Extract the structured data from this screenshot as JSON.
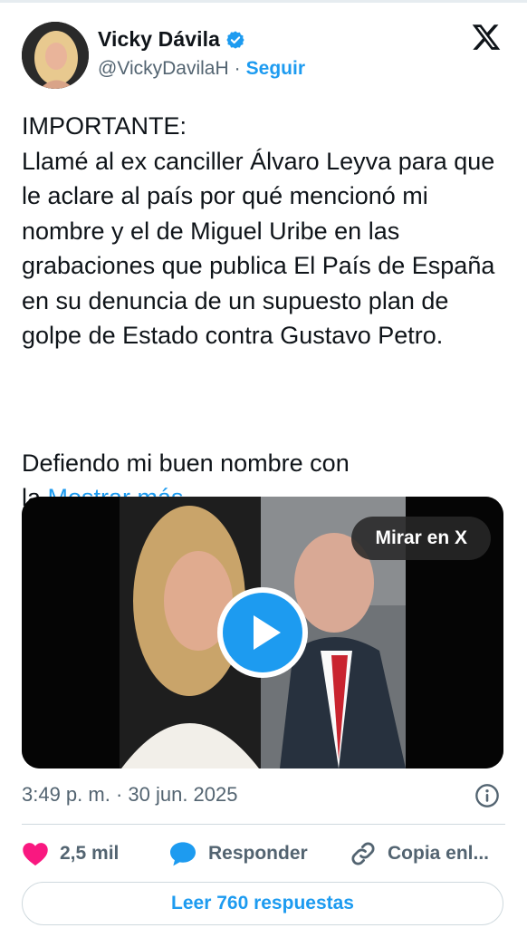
{
  "author": {
    "name": "Vicky Dávila",
    "handle": "@VickyDavilaH",
    "separator": "·",
    "follow_label": "Seguir"
  },
  "tweet": {
    "text": "IMPORTANTE:\nLlamé al ex canciller Álvaro Leyva para que le aclare al país por qué mencionó mi nombre y el de Miguel Uribe en las grabaciones que publica El País de España en su denuncia de un supuesto plan de golpe de Estado contra Gustavo Petro.",
    "continuation": "Defiendo mi buen nombre con\nla",
    "more_label": "Mostrar más"
  },
  "media": {
    "watch_label": "Mirar en X"
  },
  "timestamp": "3:49 p. m. · 30 jun. 2025",
  "actions": {
    "likes": "2,5 mil",
    "reply_label": "Responder",
    "copy_label": "Copia enl..."
  },
  "replies_button": "Leer 760 respuestas",
  "colors": {
    "accent": "#1d9bf0",
    "like": "#f91880",
    "text": "#0f1419",
    "muted": "#536471"
  },
  "icons": [
    "verified-badge-icon",
    "x-logo-icon",
    "play-icon",
    "info-icon",
    "heart-icon",
    "reply-bubble-icon",
    "link-icon"
  ]
}
